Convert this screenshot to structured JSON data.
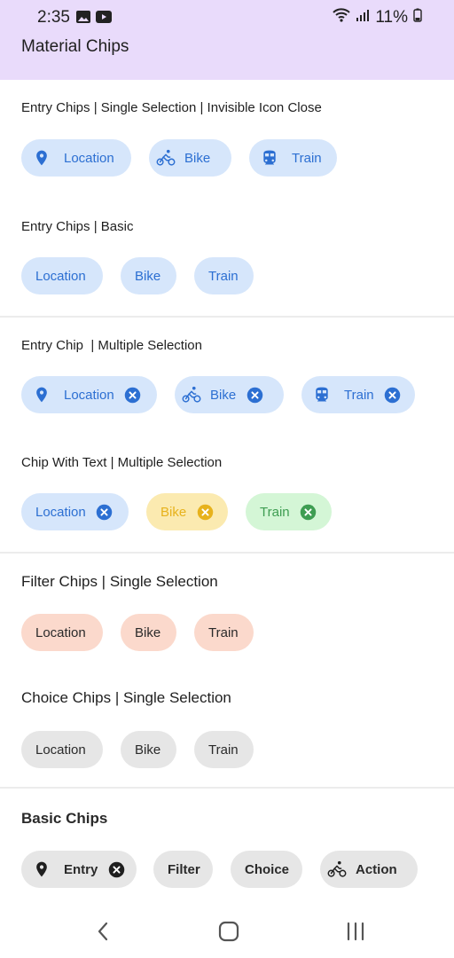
{
  "status_bar": {
    "time": "2:35",
    "battery": "11%",
    "left_icons": [
      "image-icon",
      "youtube-icon"
    ],
    "right_icons": [
      "wifi-icon",
      "signal-icon",
      "battery-icon"
    ]
  },
  "app_bar": {
    "title": "Material Chips"
  },
  "sections": [
    {
      "title": "Entry Chips | Single Selection | Invisible Icon Close",
      "chips": [
        {
          "label": "Location",
          "icon": "location-pin-icon"
        },
        {
          "label": "Bike",
          "icon": "bike-icon"
        },
        {
          "label": "Train",
          "icon": "train-icon"
        }
      ]
    },
    {
      "title": "Entry Chips | Basic",
      "chips": [
        {
          "label": "Location"
        },
        {
          "label": "Bike"
        },
        {
          "label": "Train"
        }
      ]
    },
    {
      "title": "Entry Chip  | Multiple Selection",
      "chips": [
        {
          "label": "Location",
          "icon": "location-pin-icon",
          "close": "close-icon"
        },
        {
          "label": "Bike",
          "icon": "bike-icon",
          "close": "close-icon"
        },
        {
          "label": "Train",
          "icon": "train-icon",
          "close": "close-icon"
        }
      ]
    },
    {
      "title": "Chip With Text | Multiple Selection",
      "chips": [
        {
          "label": "Location",
          "close": "close-icon",
          "color": "#2c6fd2"
        },
        {
          "label": "Bike",
          "close": "close-icon",
          "color": "#e7b21c"
        },
        {
          "label": "Train",
          "close": "close-icon",
          "color": "#3e9d52"
        }
      ]
    },
    {
      "title": "Filter Chips | Single Selection",
      "chips": [
        {
          "label": "Location"
        },
        {
          "label": "Bike"
        },
        {
          "label": "Train"
        }
      ]
    },
    {
      "title": "Choice Chips | Single Selection",
      "chips": [
        {
          "label": "Location"
        },
        {
          "label": "Bike"
        },
        {
          "label": "Train"
        }
      ]
    },
    {
      "title": "Basic Chips",
      "chips": [
        {
          "label": "Entry",
          "icon": "location-pin-icon",
          "close": "close-icon"
        },
        {
          "label": "Filter"
        },
        {
          "label": "Choice"
        },
        {
          "label": "Action",
          "icon": "bike-icon"
        }
      ]
    }
  ],
  "nav_bar": {
    "buttons": [
      "back-icon",
      "home-icon",
      "recents-icon"
    ]
  },
  "colors": {
    "header_bg": "#e9dbfb",
    "chip_blue_bg": "#d6e6fb",
    "chip_blue_fg": "#2c6fd2",
    "chip_yellow_bg": "#fbeab0",
    "chip_green_bg": "#d4f6d6",
    "chip_peach_bg": "#fbd9cc",
    "chip_grey_bg": "#e6e6e6"
  }
}
